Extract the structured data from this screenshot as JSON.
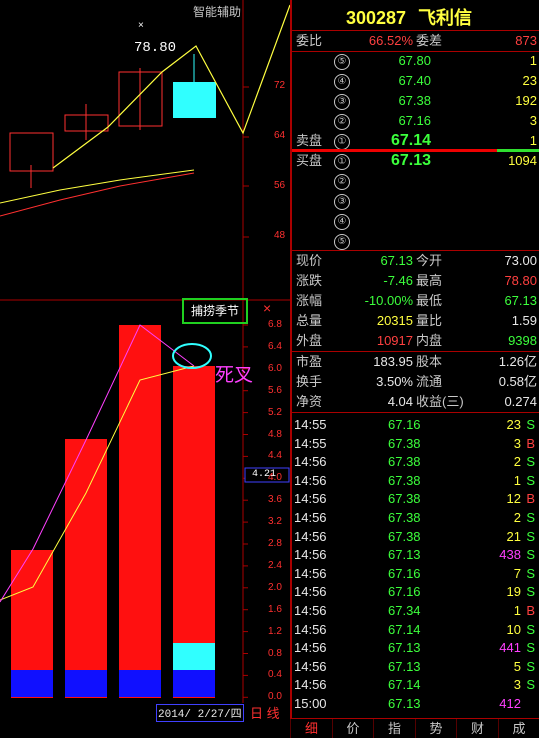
{
  "header": {
    "code": "300287",
    "name": "飞利信"
  },
  "chart": {
    "indicator_label": "智能辅助",
    "high_marker": "78.80",
    "high_marker_x": "×",
    "price_axis": [
      "72",
      "64",
      "56",
      "48"
    ],
    "lower_button": "捕捞季节",
    "close_icon": "×",
    "annotation": "死叉",
    "lower_axis": [
      "6.8",
      "6.4",
      "6.0",
      "5.6",
      "5.2",
      "4.8",
      "4.4",
      "4.0",
      "3.6",
      "3.2",
      "2.8",
      "2.4",
      "2.0",
      "1.6",
      "1.2",
      "0.8",
      "0.4",
      "0.0"
    ],
    "current_value": "4.21",
    "date": "2014/ 2/27/四",
    "period": "日 线"
  },
  "order_book": {
    "weibi_label": "委比",
    "weibi_value": "66.52%",
    "weicha_label": "委差",
    "weicha_value": "873",
    "sell_label": "卖盘",
    "buy_label": "买盘",
    "sells": [
      {
        "num": "⑤",
        "price": "67.80",
        "vol": "1"
      },
      {
        "num": "④",
        "price": "67.40",
        "vol": "23"
      },
      {
        "num": "③",
        "price": "67.38",
        "vol": "192"
      },
      {
        "num": "②",
        "price": "67.16",
        "vol": "3"
      },
      {
        "num": "①",
        "price": "67.14",
        "vol": "1"
      }
    ],
    "buys": [
      {
        "num": "①",
        "price": "67.13",
        "vol": "1094"
      },
      {
        "num": "②",
        "price": "",
        "vol": ""
      },
      {
        "num": "③",
        "price": "",
        "vol": ""
      },
      {
        "num": "④",
        "price": "",
        "vol": ""
      },
      {
        "num": "⑤",
        "price": "",
        "vol": ""
      }
    ]
  },
  "quote": [
    {
      "l1": "现价",
      "v1": "67.13",
      "c1": "green",
      "l2": "今开",
      "v2": "73.00",
      "c2": "white"
    },
    {
      "l1": "涨跌",
      "v1": "-7.46",
      "c1": "green",
      "l2": "最高",
      "v2": "78.80",
      "c2": "red"
    },
    {
      "l1": "涨幅",
      "v1": "-10.00%",
      "c1": "green",
      "l2": "最低",
      "v2": "67.13",
      "c2": "green"
    },
    {
      "l1": "总量",
      "v1": "20315",
      "c1": "yellow",
      "l2": "量比",
      "v2": "1.59",
      "c2": "white"
    },
    {
      "l1": "外盘",
      "v1": "10917",
      "c1": "red",
      "l2": "内盘",
      "v2": "9398",
      "c2": "green"
    }
  ],
  "fundamentals": [
    {
      "l1": "市盈",
      "v1": "183.95",
      "l2": "股本",
      "v2": "1.26亿"
    },
    {
      "l1": "换手",
      "v1": "3.50%",
      "l2": "流通",
      "v2": "0.58亿"
    },
    {
      "l1": "净资",
      "v1": "4.04",
      "l2": "收益(三)",
      "v2": "0.274"
    }
  ],
  "ticks": [
    {
      "time": "14:55",
      "price": "67.16",
      "vol": "23",
      "vc": "yellow",
      "side": "S"
    },
    {
      "time": "14:55",
      "price": "67.38",
      "vol": "3",
      "vc": "yellow",
      "side": "B"
    },
    {
      "time": "14:56",
      "price": "67.38",
      "vol": "2",
      "vc": "yellow",
      "side": "S"
    },
    {
      "time": "14:56",
      "price": "67.38",
      "vol": "1",
      "vc": "yellow",
      "side": "S"
    },
    {
      "time": "14:56",
      "price": "67.38",
      "vol": "12",
      "vc": "yellow",
      "side": "B"
    },
    {
      "time": "14:56",
      "price": "67.38",
      "vol": "2",
      "vc": "yellow",
      "side": "S"
    },
    {
      "time": "14:56",
      "price": "67.38",
      "vol": "21",
      "vc": "yellow",
      "side": "S"
    },
    {
      "time": "14:56",
      "price": "67.13",
      "vol": "438",
      "vc": "magenta",
      "side": "S"
    },
    {
      "time": "14:56",
      "price": "67.16",
      "vol": "7",
      "vc": "yellow",
      "side": "S"
    },
    {
      "time": "14:56",
      "price": "67.16",
      "vol": "19",
      "vc": "yellow",
      "side": "S"
    },
    {
      "time": "14:56",
      "price": "67.34",
      "vol": "1",
      "vc": "yellow",
      "side": "B"
    },
    {
      "time": "14:56",
      "price": "67.14",
      "vol": "10",
      "vc": "yellow",
      "side": "S"
    },
    {
      "time": "14:56",
      "price": "67.13",
      "vol": "441",
      "vc": "magenta",
      "side": "S"
    },
    {
      "time": "14:56",
      "price": "67.13",
      "vol": "5",
      "vc": "yellow",
      "side": "S"
    },
    {
      "time": "14:56",
      "price": "67.14",
      "vol": "3",
      "vc": "yellow",
      "side": "S"
    },
    {
      "time": "15:00",
      "price": "67.13",
      "vol": "412",
      "vc": "magenta",
      "side": ""
    }
  ],
  "tabs": [
    "细",
    "价",
    "指",
    "势",
    "财",
    "成"
  ]
}
